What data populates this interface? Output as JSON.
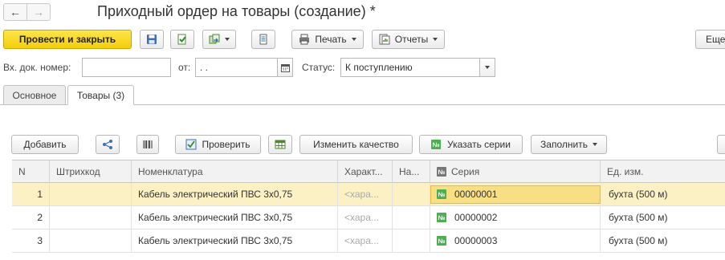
{
  "window": {
    "title": "Приходный ордер на товары (создание) *"
  },
  "toolbar": {
    "post_close_label": "Провести и закрыть",
    "print_label": "Печать",
    "reports_label": "Отчеты",
    "more_label": "Еще"
  },
  "fields": {
    "incoming_number_label": "Вх. док. номер:",
    "incoming_number_value": "",
    "date_label": "от:",
    "date_value": " .  .",
    "status_label": "Статус:",
    "status_value": "К поступлению"
  },
  "tabs": [
    {
      "label": "Основное",
      "active": false
    },
    {
      "label": "Товары (3)",
      "active": true
    }
  ],
  "goods_toolbar": {
    "add_label": "Добавить",
    "check_label": "Проверить",
    "change_quality_label": "Изменить качество",
    "set_series_label": "Указать серии",
    "fill_label": "Заполнить"
  },
  "table": {
    "columns": [
      "N",
      "Штрихкод",
      "Номенклатура",
      "Характ...",
      "На...",
      "Серия",
      "Ед. изм."
    ],
    "rows": [
      {
        "n": "1",
        "barcode": "",
        "item": "Кабель электрический ПВС 3х0,75",
        "characteristic": "<хара...",
        "na": "",
        "series": "00000001",
        "unit": "бухта (500 м)",
        "selected": true
      },
      {
        "n": "2",
        "barcode": "",
        "item": "Кабель электрический ПВС 3х0,75",
        "characteristic": "<хара...",
        "na": "",
        "series": "00000002",
        "unit": "бухта (500 м)",
        "selected": false
      },
      {
        "n": "3",
        "barcode": "",
        "item": "Кабель электрический ПВС 3х0,75",
        "characteristic": "<хара...",
        "na": "",
        "series": "00000003",
        "unit": "бухта (500 м)",
        "selected": false
      }
    ]
  },
  "colors": {
    "primary_button": "#f5cf0c",
    "selected_row": "#fbf1c4",
    "series_badge": "#4caf50"
  }
}
